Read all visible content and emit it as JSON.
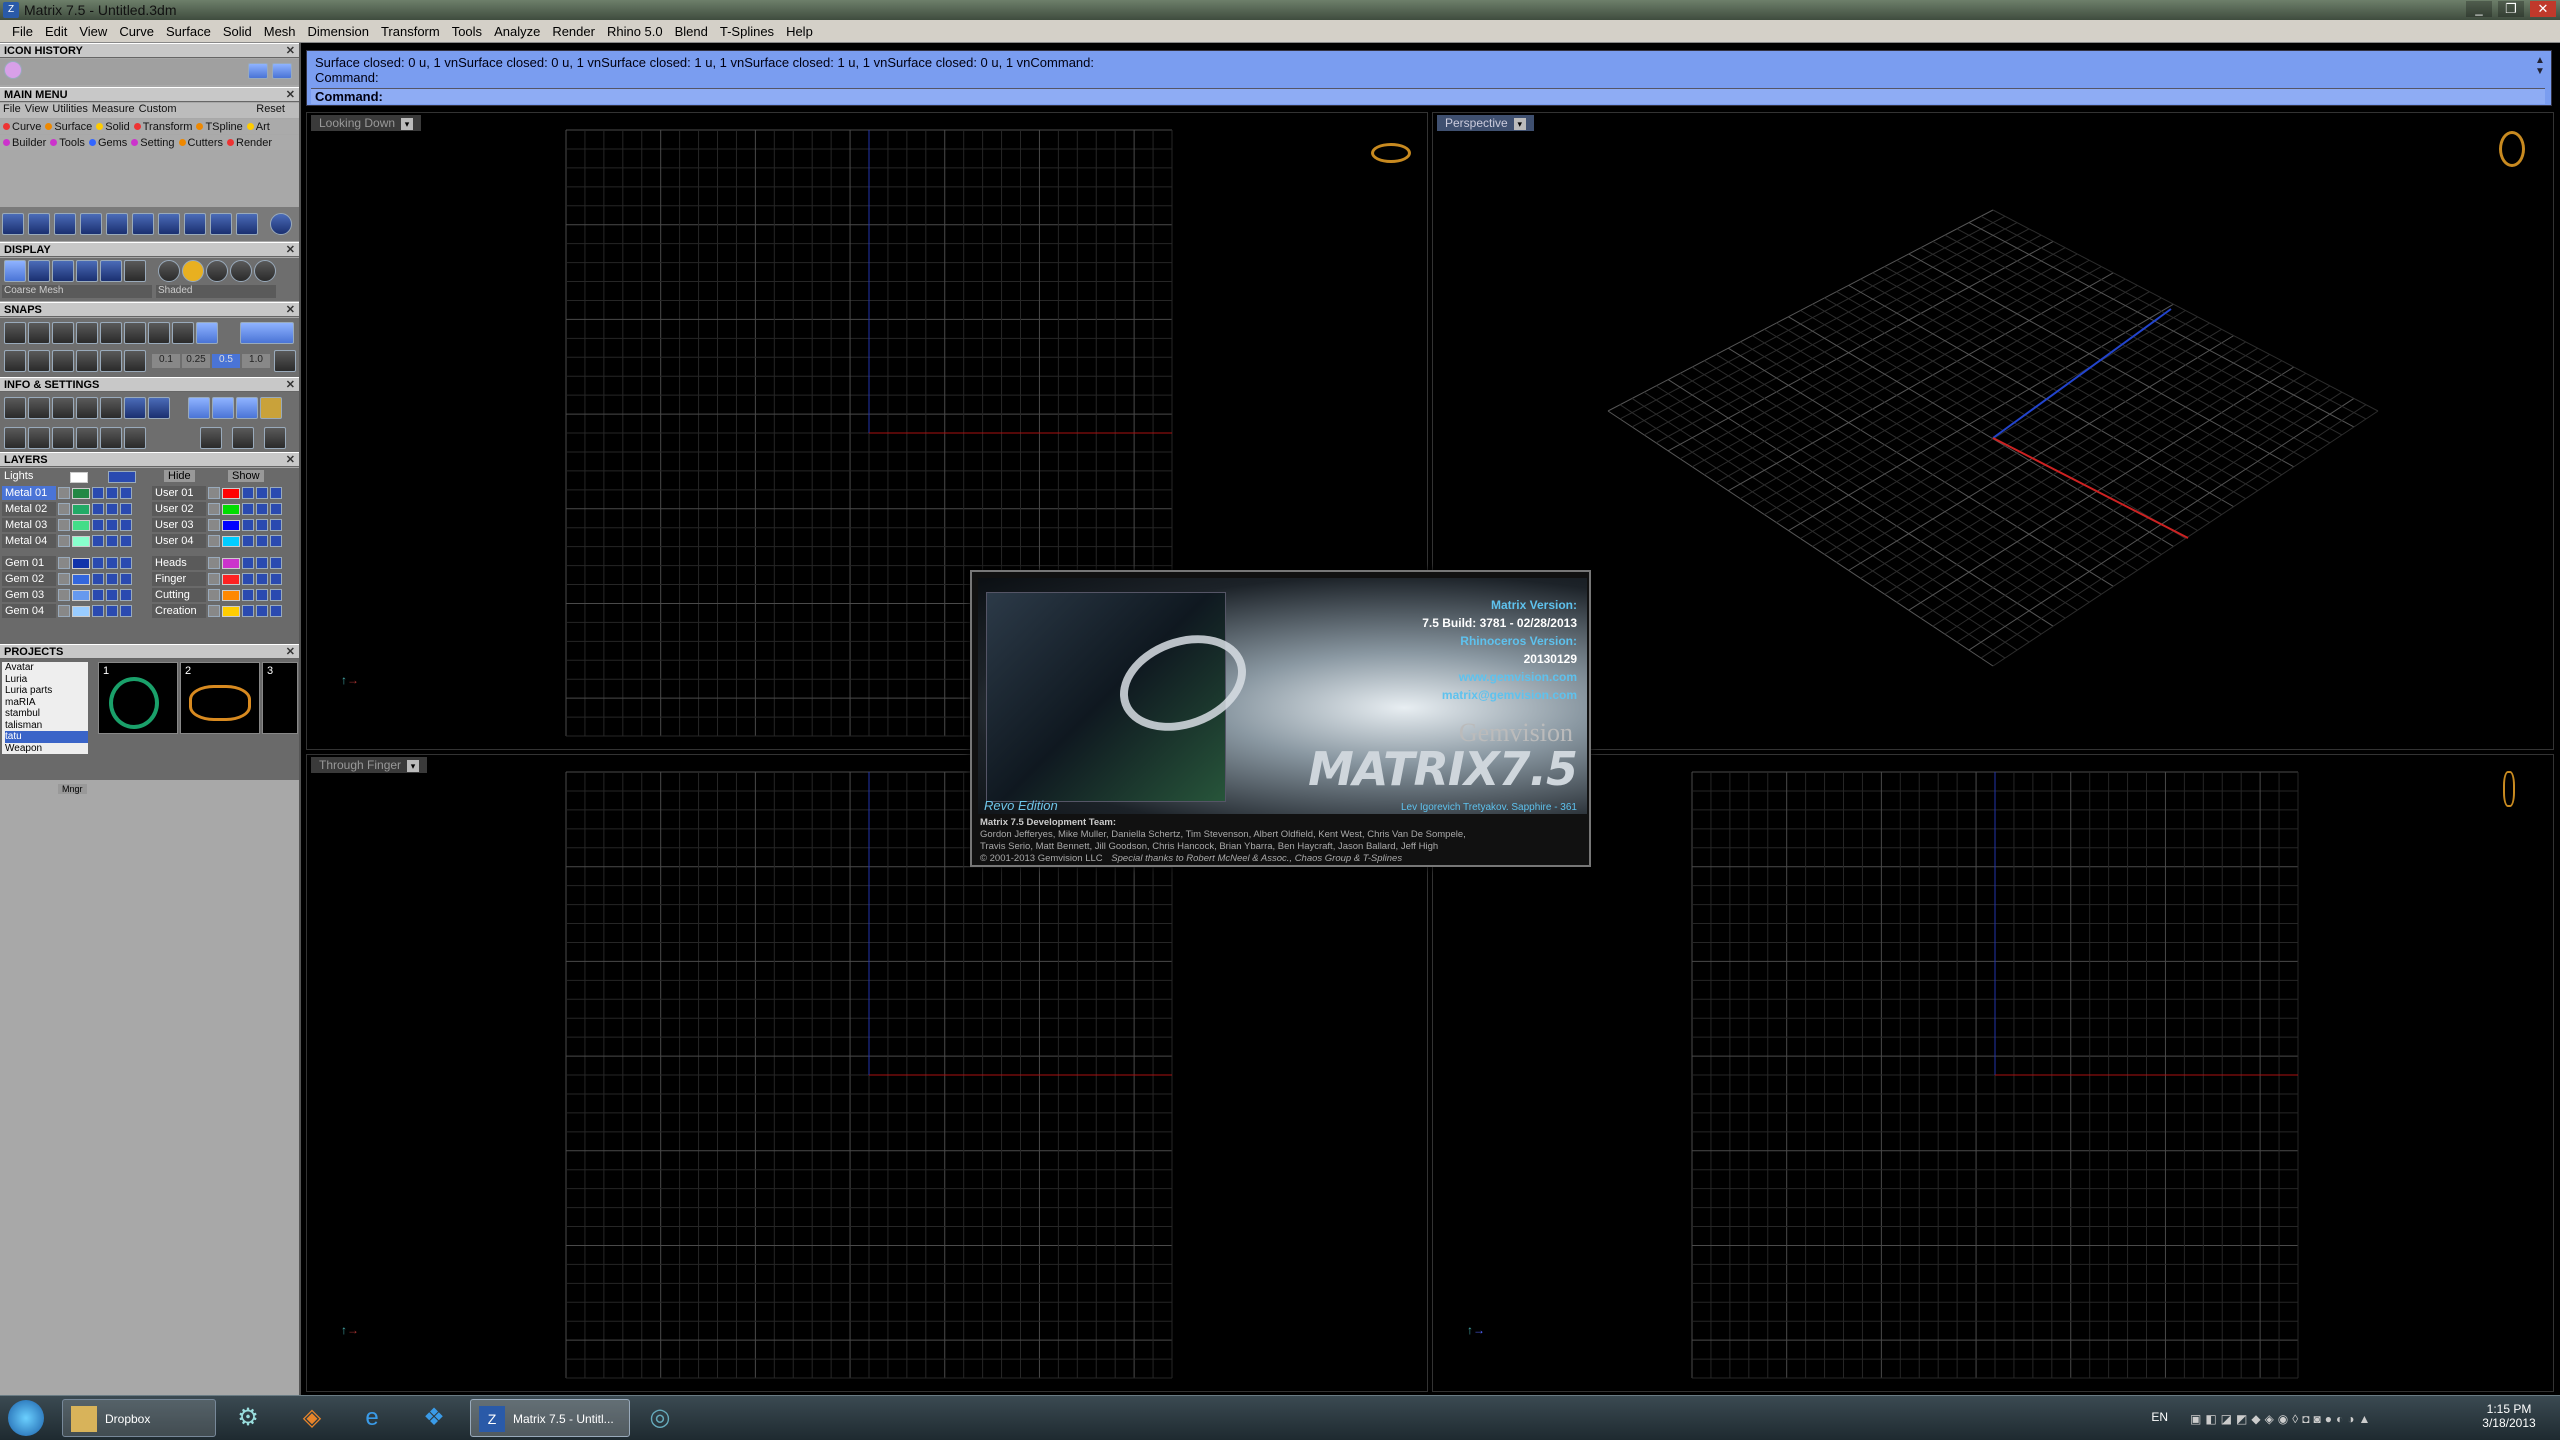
{
  "window": {
    "title": "Matrix 7.5 - Untitled.3dm",
    "controls": [
      "_",
      "❐",
      "✕"
    ],
    "app_icon": "matrix-z-icon"
  },
  "menubar": [
    "File",
    "Edit",
    "View",
    "Curve",
    "Surface",
    "Solid",
    "Mesh",
    "Dimension",
    "Transform",
    "Tools",
    "Analyze",
    "Render",
    "Rhino 5.0",
    "Blend",
    "T-Splines",
    "Help"
  ],
  "left": {
    "icon_history": "ICON HISTORY",
    "main_menu": "MAIN MENU",
    "main_menu_tabs": [
      "File",
      "View",
      "Utilities",
      "Measure",
      "Custom"
    ],
    "reset": "Reset",
    "cat_row1": [
      "Curve",
      "Surface",
      "Solid",
      "Transform",
      "TSpline",
      "Art"
    ],
    "cat_row2": [
      "Builder",
      "Tools",
      "Gems",
      "Setting",
      "Cutters",
      "Render"
    ],
    "display": "DISPLAY",
    "display_mesh": "Coarse Mesh",
    "display_mode": "Shaded",
    "snaps": "SNAPS",
    "snap_values": [
      "0.1",
      "0.25",
      "0.5",
      "1.0"
    ],
    "info_settings": "INFO & SETTINGS",
    "layers": "LAYERS",
    "lights": "Lights",
    "hide": "Hide",
    "show": "Show",
    "layers_left": [
      "Metal 01",
      "Metal 02",
      "Metal 03",
      "Metal 04",
      "Gem 01",
      "Gem 02",
      "Gem 03",
      "Gem 04"
    ],
    "layers_right": [
      "User 01",
      "User 02",
      "User 03",
      "User 04",
      "Heads",
      "Finger",
      "Cutting",
      "Creation"
    ],
    "layer_colors_left": [
      "#228844",
      "#22aa66",
      "#44dd88",
      "#88ffcc",
      "#1133aa",
      "#3366dd",
      "#6699ee",
      "#99ccff"
    ],
    "layer_colors_right": [
      "#ff0000",
      "#00dd00",
      "#0000ff",
      "#00ccff",
      "#cc33cc",
      "#ff2222",
      "#ff8800",
      "#ffcc00"
    ],
    "projects": "PROJECTS",
    "project_list": [
      "Avatar",
      "Luria",
      "Luria parts",
      "maRIA",
      "stambul",
      "talisman",
      "tatu",
      "Weapon"
    ],
    "project_thumbs": [
      "1",
      "2",
      "3"
    ],
    "mngr": "Mngr"
  },
  "command": {
    "history1": "Surface closed: 0 u, 1 vnSurface closed: 0 u, 1 vnSurface closed: 1 u, 1 vnSurface closed: 1 u, 1 vnSurface closed: 0 u, 1 vnCommand:",
    "history2": "Command:",
    "prompt": "Command:"
  },
  "viewports": {
    "top_left": "Looking Down",
    "top_right": "Perspective",
    "bottom_left": "Through Finger",
    "bottom_right": ""
  },
  "splash": {
    "matrix_version_label": "Matrix Version:",
    "matrix_version": "7.5 Build: 3781 - 02/28/2013",
    "rhino_label": "Rhinoceros Version:",
    "rhino_version": "20130129",
    "website": "www.gemvision.com",
    "email": "matrix@gemvision.com",
    "brand": "Gemvision",
    "logo": "MATRIX7.5",
    "licensee": "Lev Igorevich Tretyakov. Sapphire - 361",
    "edition": "Revo Edition",
    "team_title": "Matrix 7.5 Development Team:",
    "team_line1": "Gordon Jefferyes, Mike Muller, Daniella Schertz, Tim Stevenson, Albert Oldfield, Kent West, Chris Van De Sompele,",
    "team_line2": "Travis Serio, Matt Bennett, Jill Goodson, Chris Hancock, Brian Ybarra, Ben Haycraft, Jason Ballard, Jeff High",
    "copyright": "© 2001-2013 Gemvision LLC",
    "thanks": "Special thanks to Robert McNeel & Assoc., Chaos Group & T-Splines"
  },
  "taskbar": {
    "dropbox": "Dropbox",
    "matrix_task": "Matrix 7.5 - Untitl...",
    "lang": "EN",
    "time": "1:15 PM",
    "date": "3/18/2013"
  }
}
